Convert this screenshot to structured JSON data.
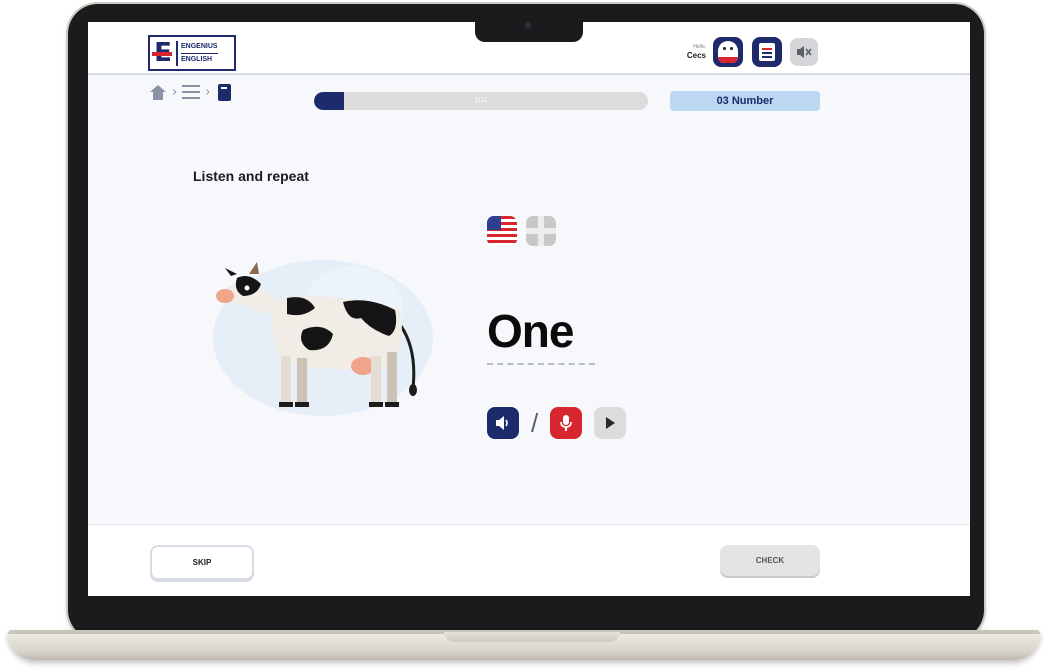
{
  "header": {
    "logo_line1": "ENGENIUS",
    "logo_line2": "ENGLISH",
    "greeting": "Hello,",
    "user_name": "Cecs"
  },
  "breadcrumb": {
    "items": [
      "home-icon",
      "menu-icon",
      "book-icon"
    ]
  },
  "progress": {
    "label": "1/11",
    "fraction": 0.09
  },
  "topic": "03 Number",
  "exercise": {
    "instruction": "Listen and repeat",
    "word": "One",
    "accents": [
      "us-flag-icon",
      "uk-flag-icon"
    ],
    "controls": [
      "speaker-icon",
      "microphone-icon",
      "play-icon"
    ],
    "separator": "/"
  },
  "footer": {
    "skip_label": "SKIP",
    "check_label": "CHECK"
  },
  "colors": {
    "brand_navy": "#1d2a6b",
    "brand_red": "#d8262e",
    "topic_pill": "#bcd7f1"
  }
}
